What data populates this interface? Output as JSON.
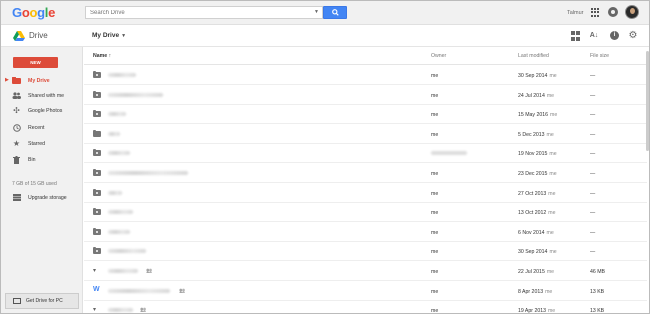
{
  "topbar": {
    "logo_letters": [
      "G",
      "o",
      "o",
      "g",
      "l",
      "e"
    ],
    "search_placeholder": "Search Drive",
    "user_name": "Talmur"
  },
  "subbar": {
    "app_title": "Drive",
    "location": "My Drive"
  },
  "sidebar": {
    "new_label": "NEW",
    "items": [
      {
        "label": "My Drive",
        "icon": "drive-folder-icon",
        "active": true
      },
      {
        "label": "Shared with me",
        "icon": "people-icon"
      },
      {
        "label": "Google Photos",
        "icon": "pinwheel-icon"
      },
      {
        "label": "Recent",
        "icon": "clock-icon"
      },
      {
        "label": "Starred",
        "icon": "star-icon"
      },
      {
        "label": "Bin",
        "icon": "trash-icon"
      }
    ],
    "storage": "7 GB of 15 GB used",
    "upgrade": "Upgrade storage",
    "get_drive": "Get Drive for PC"
  },
  "list": {
    "headers": {
      "name": "Name",
      "owner": "Owner",
      "modified": "Last modified",
      "size": "File size"
    },
    "rows": [
      {
        "type": "shared-folder",
        "owner": "me",
        "modified": "30 Sep 2014",
        "by": "me",
        "size": "—"
      },
      {
        "type": "shared-folder",
        "owner": "me",
        "modified": "24 Jul 2014",
        "by": "me",
        "size": "—"
      },
      {
        "type": "shared-folder",
        "owner": "me",
        "modified": "15 May 2016",
        "by": "me",
        "size": "—"
      },
      {
        "type": "folder",
        "owner": "me",
        "modified": "5 Dec 2013",
        "by": "me",
        "size": "—"
      },
      {
        "type": "shared-folder",
        "owner": "",
        "modified": "19 Nov 2015",
        "by": "me",
        "size": "—"
      },
      {
        "type": "shared-folder",
        "owner": "me",
        "modified": "23 Dec 2015",
        "by": "me",
        "size": "—"
      },
      {
        "type": "shared-folder",
        "owner": "me",
        "modified": "27 Oct 2013",
        "by": "me",
        "size": "—"
      },
      {
        "type": "shared-folder",
        "owner": "me",
        "modified": "13 Oct 2012",
        "by": "me",
        "size": "—"
      },
      {
        "type": "shared-folder",
        "owner": "me",
        "modified": "6 Nov 2014",
        "by": "me",
        "size": "—"
      },
      {
        "type": "shared-folder",
        "owner": "me",
        "modified": "30 Sep 2014",
        "by": "me",
        "size": "—"
      },
      {
        "type": "file",
        "owner": "me",
        "modified": "22 Jul 2015",
        "by": "me",
        "size": "46 MB"
      },
      {
        "type": "doc",
        "owner": "me",
        "modified": "8 Apr 2013",
        "by": "me",
        "size": "13 KB"
      },
      {
        "type": "file",
        "owner": "me",
        "modified": "19 Apr 2013",
        "by": "me",
        "size": "13 KB"
      }
    ]
  }
}
